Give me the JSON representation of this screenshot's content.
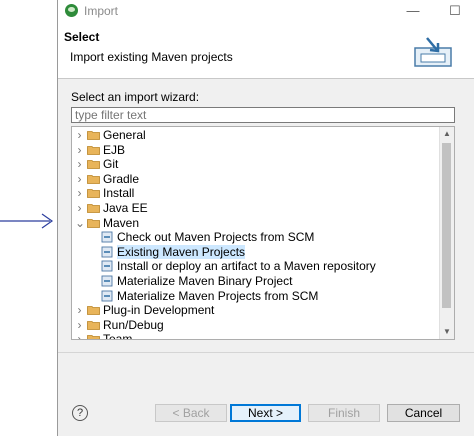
{
  "window": {
    "title": "Import",
    "minimize_glyph": "—",
    "maximize_glyph": "☐"
  },
  "header": {
    "title": "Select",
    "description": "Import existing Maven projects"
  },
  "wizard": {
    "label": "Select an import wizard:",
    "filter_placeholder": "type filter text"
  },
  "tree": {
    "items": [
      {
        "label": "General",
        "type": "folder",
        "expanded": false,
        "level": 0
      },
      {
        "label": "EJB",
        "type": "folder",
        "expanded": false,
        "level": 0
      },
      {
        "label": "Git",
        "type": "folder",
        "expanded": false,
        "level": 0
      },
      {
        "label": "Gradle",
        "type": "folder",
        "expanded": false,
        "level": 0
      },
      {
        "label": "Install",
        "type": "folder",
        "expanded": false,
        "level": 0
      },
      {
        "label": "Java EE",
        "type": "folder",
        "expanded": false,
        "level": 0
      },
      {
        "label": "Maven",
        "type": "folder",
        "expanded": true,
        "level": 0
      },
      {
        "label": "Check out Maven Projects from SCM",
        "type": "item",
        "level": 1
      },
      {
        "label": "Existing Maven Projects",
        "type": "item",
        "level": 1,
        "selected": true
      },
      {
        "label": "Install or deploy an artifact to a Maven repository",
        "type": "item",
        "level": 1
      },
      {
        "label": "Materialize Maven Binary Project",
        "type": "item",
        "level": 1
      },
      {
        "label": "Materialize Maven Projects from SCM",
        "type": "item",
        "level": 1
      },
      {
        "label": "Plug-in Development",
        "type": "folder",
        "expanded": false,
        "level": 0
      },
      {
        "label": "Run/Debug",
        "type": "folder",
        "expanded": false,
        "level": 0
      },
      {
        "label": "Team",
        "type": "folder",
        "expanded": false,
        "level": 0
      }
    ]
  },
  "buttons": {
    "help": "?",
    "back": "< Back",
    "next": "Next >",
    "finish": "Finish",
    "cancel": "Cancel"
  },
  "colors": {
    "folder": "#e8b45a",
    "selection": "#cde8ff",
    "annotation_arrow": "#2c3e9e",
    "primary_border": "#0078d7"
  }
}
